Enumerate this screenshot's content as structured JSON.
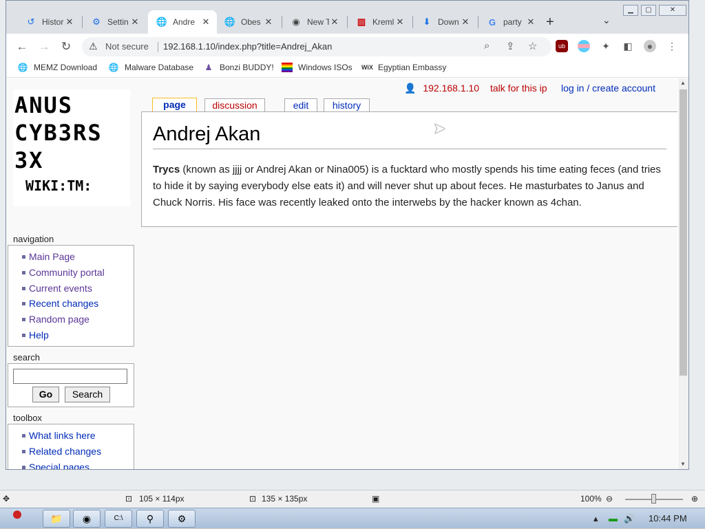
{
  "browser": {
    "tabs": [
      {
        "label": "Histor",
        "icon": "history-icon"
      },
      {
        "label": "Settin",
        "icon": "gear-icon"
      },
      {
        "label": "Andre",
        "icon": "globe-icon"
      },
      {
        "label": "Obes",
        "icon": "globe-icon"
      },
      {
        "label": "New T",
        "icon": "chrome-icon"
      },
      {
        "label": "Kreml",
        "icon": "kremlin-icon"
      },
      {
        "label": "Down",
        "icon": "download-icon"
      },
      {
        "label": "party",
        "icon": "google-icon"
      }
    ],
    "active_tab_index": 2,
    "security_label": "Not secure",
    "url": "192.168.1.10/index.php?title=Andrej_Akan",
    "bookmarks": [
      {
        "label": "MEMZ Download"
      },
      {
        "label": "Malware Database"
      },
      {
        "label": "Bonzi BUDDY!"
      },
      {
        "label": "Windows ISOs"
      },
      {
        "label": "Egyptian Embassy"
      }
    ]
  },
  "wiki": {
    "logo_lines": [
      "ANUS",
      "CYB3RS",
      "3X",
      "WIKI:TM:"
    ],
    "userbar": {
      "ip": "192.168.1.10",
      "talk": "talk for this ip",
      "login": "log in / create account"
    },
    "page_tabs": [
      {
        "label": "page"
      },
      {
        "label": "discussion"
      },
      {
        "label": "edit"
      },
      {
        "label": "history"
      }
    ],
    "navigation": {
      "heading": "navigation",
      "items": [
        "Main Page",
        "Community portal",
        "Current events",
        "Recent changes",
        "Random page",
        "Help"
      ]
    },
    "search": {
      "heading": "search",
      "value": "",
      "go_label": "Go",
      "search_label": "Search"
    },
    "toolbox": {
      "heading": "toolbox",
      "items": [
        "What links here",
        "Related changes",
        "Special pages"
      ]
    },
    "article": {
      "title": "Andrej Akan",
      "lead_bold": "Trycs",
      "body": " (known as jjjj or Andrej Akan or Nina005) is a fucktard who mostly spends his time eating feces (and tries to hide it by saying everybody else eats it) and will never shut up about feces. He masturbates to Janus and Chuck Norris. His face was recently leaked onto the interwebs by the hacker known as 4chan."
    }
  },
  "statusbar": {
    "size1": "105 × 114px",
    "size2": "135 × 135px",
    "zoom": "100%"
  },
  "taskbar": {
    "clock": "10:44 PM"
  },
  "colors": {
    "visited_link": "#5a3696",
    "link": "#002bb8",
    "new_link": "#ba0000"
  }
}
